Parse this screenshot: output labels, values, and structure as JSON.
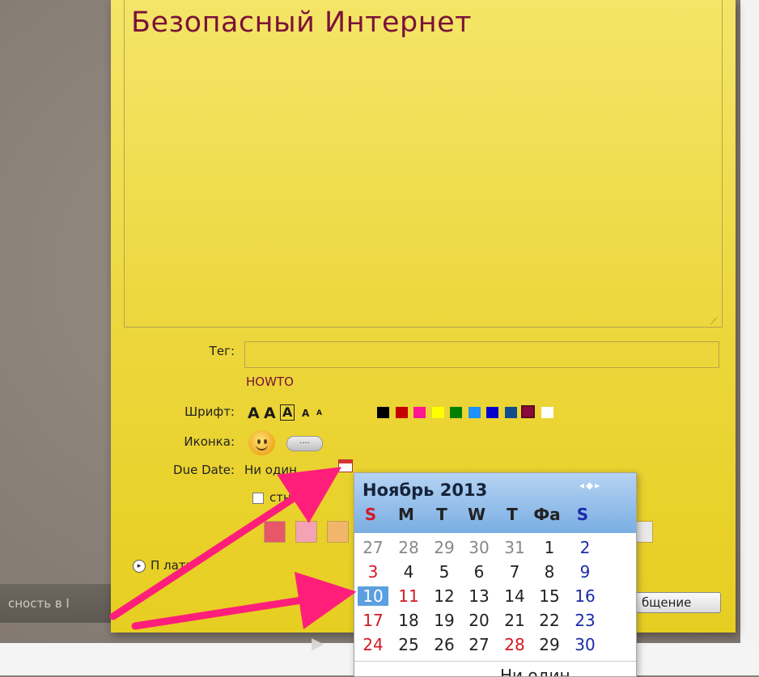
{
  "note": {
    "title": "Безопасный Интернет",
    "tag_label": "Тег:",
    "tag_value": "",
    "tag_suggestion": "HOWTO",
    "font_label": "Шрифт:",
    "font_sizes": [
      "A",
      "A",
      "A",
      "A",
      "A"
    ],
    "colors": [
      "#000000",
      "#c70000",
      "#ff1493",
      "#ffff00",
      "#008000",
      "#1e90ff",
      "#0000cd",
      "#104e8b",
      "#8b0a3a",
      "#ffffff"
    ],
    "icon_label": "Иконка:",
    "more_icons": "....",
    "due_label": "Due Date:",
    "due_value": "Ни один",
    "public_label": "стный",
    "bg_colors": [
      "#e8566a",
      "#f4a3b4",
      "#f2b66a"
    ],
    "send_label": "П  лать",
    "save_label": "бщение"
  },
  "background": {
    "strip_text": "сность в I"
  },
  "calendar": {
    "month": "Ноябрь 2013",
    "nav": "◂◆▸",
    "weekdays": [
      "S",
      "M",
      "T",
      "W",
      "T",
      "Фа",
      "S"
    ],
    "weeks": [
      [
        "27",
        "28",
        "29",
        "30",
        "31",
        "1",
        "2"
      ],
      [
        "3",
        "4",
        "5",
        "6",
        "7",
        "8",
        "9"
      ],
      [
        "10",
        "11",
        "12",
        "13",
        "14",
        "15",
        "16"
      ],
      [
        "17",
        "18",
        "19",
        "20",
        "21",
        "22",
        "23"
      ],
      [
        "24",
        "25",
        "26",
        "27",
        "28",
        "29",
        "30"
      ]
    ],
    "today": "10",
    "none_label": "Ни один"
  }
}
